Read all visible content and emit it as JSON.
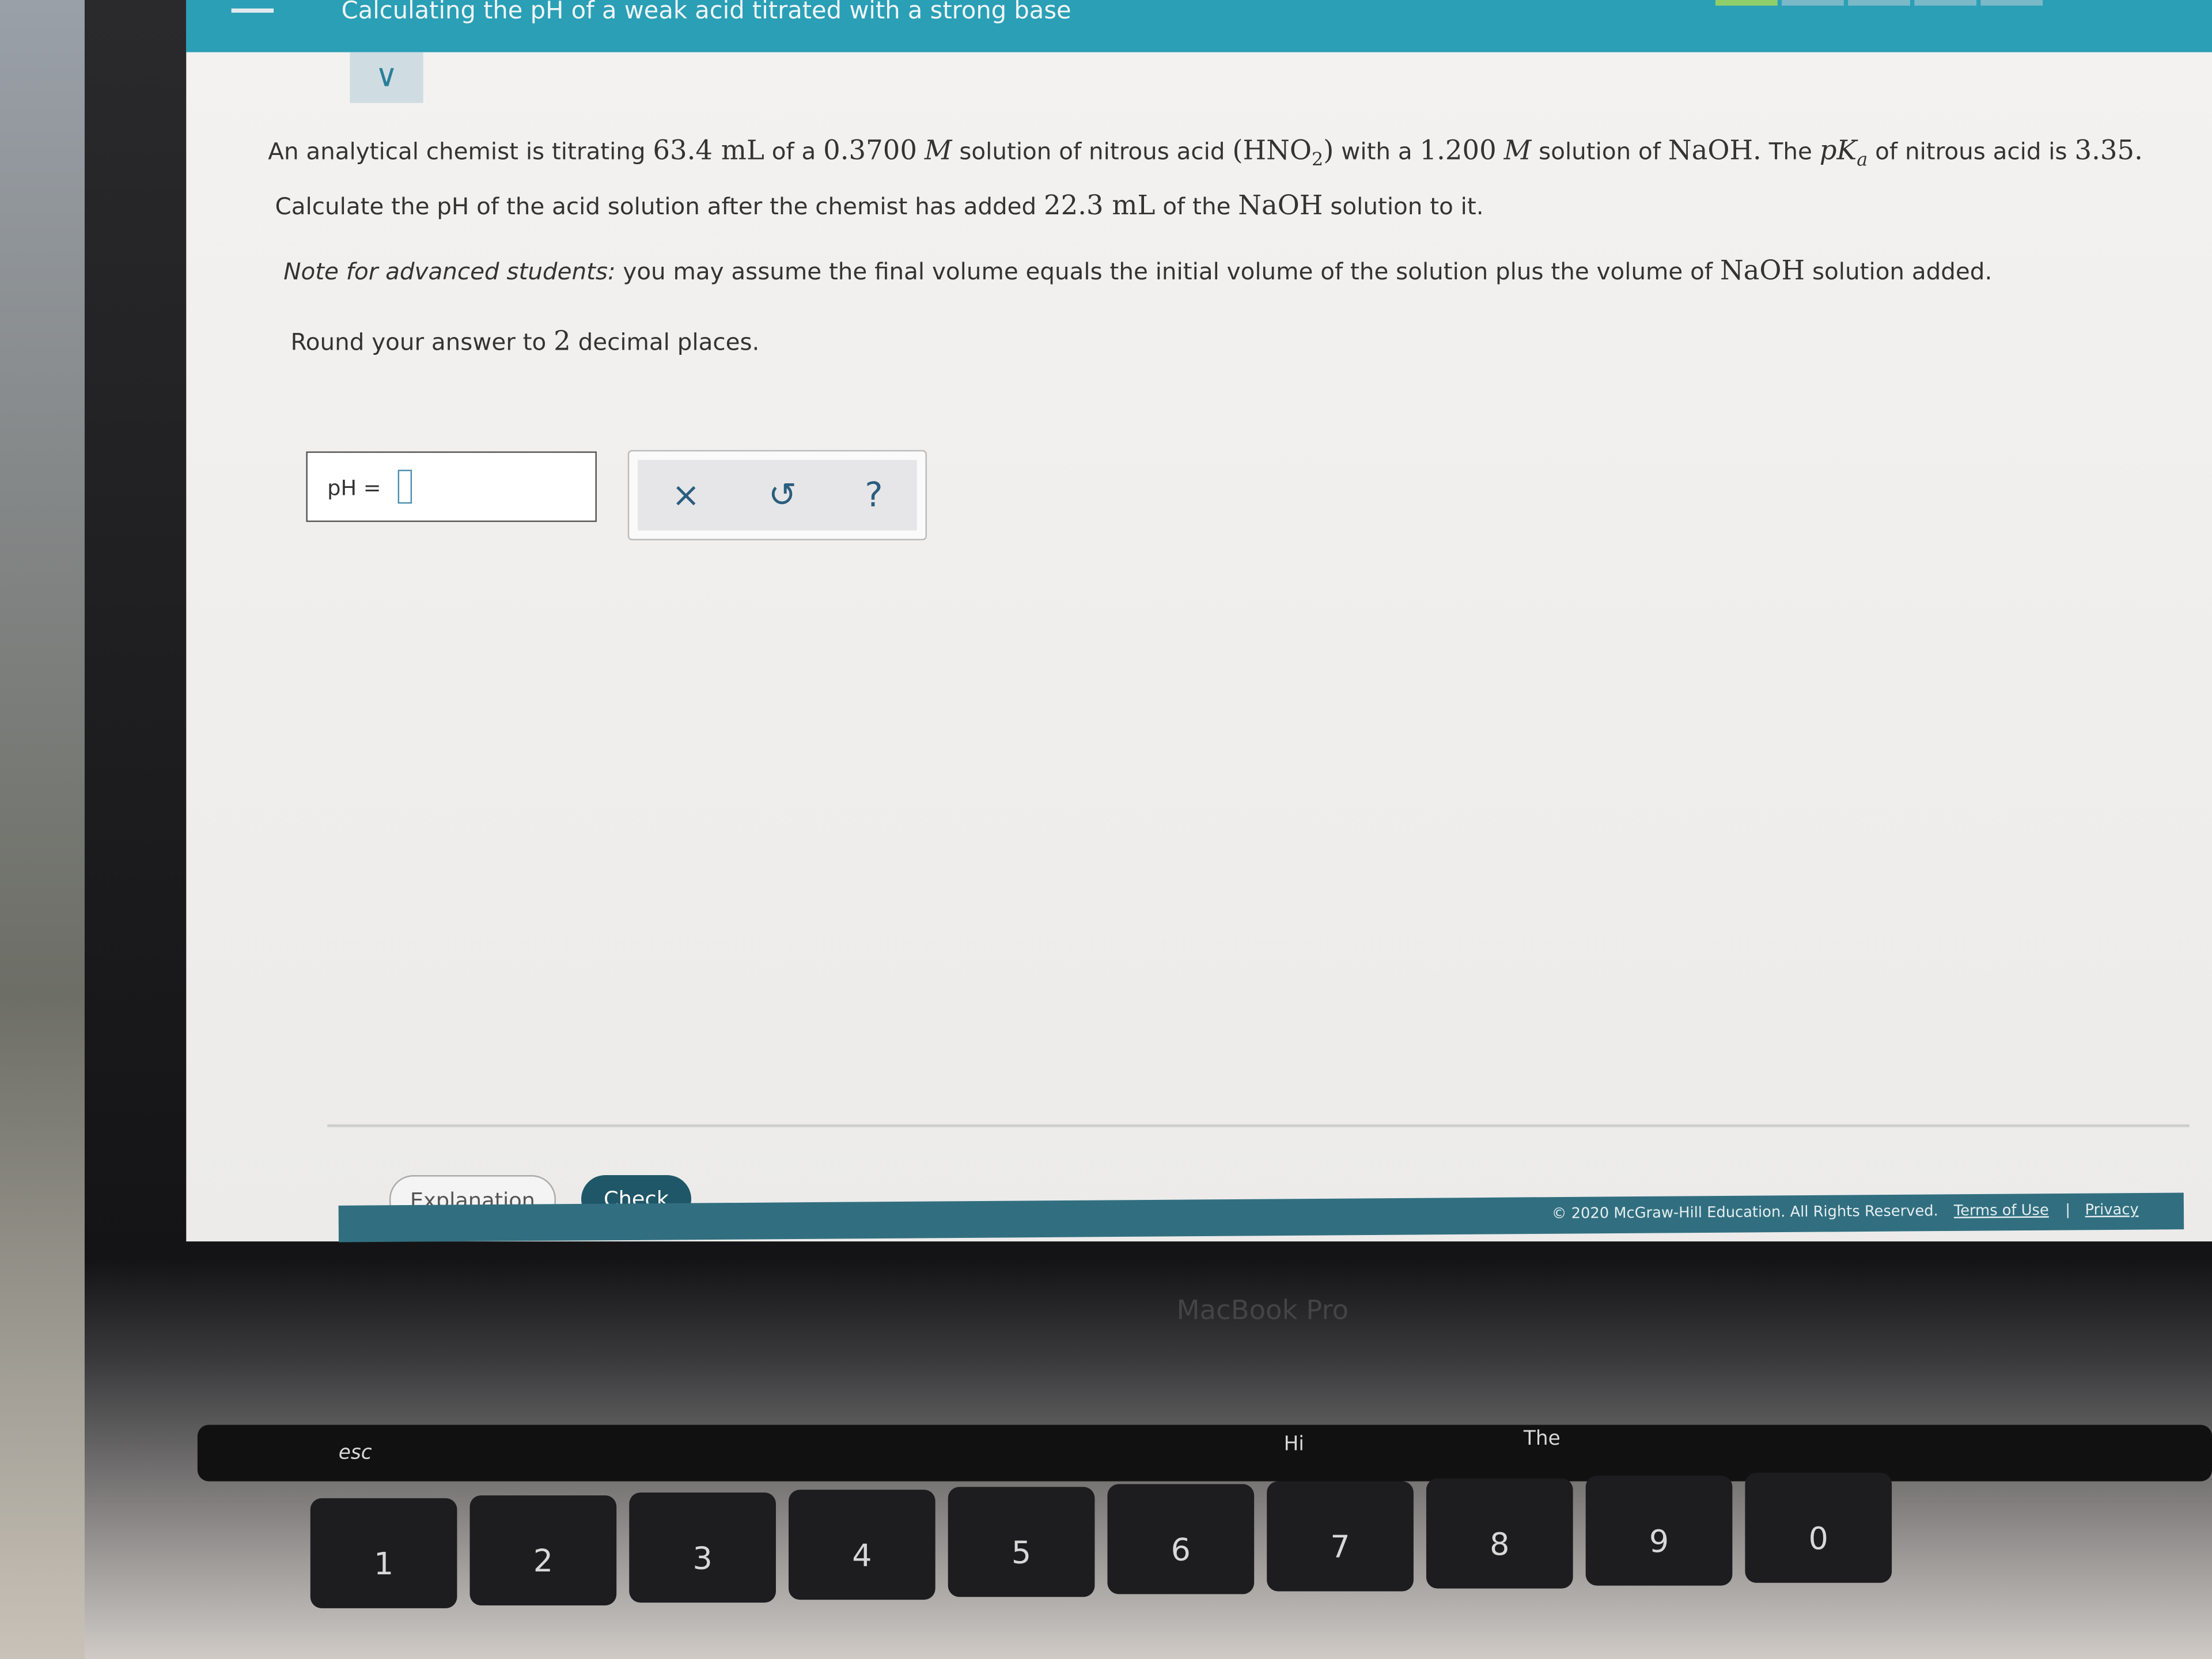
{
  "header": {
    "title": "Calculating the pH of a weak acid titrated with a strong base",
    "progress": {
      "completed_segments": 1,
      "total_segments": 5,
      "complete_color": "#8fcf6a"
    }
  },
  "question": {
    "line1": {
      "a": "An analytical chemist is titrating",
      "v1": "63.4 mL",
      "b": "of a",
      "v2": "0.3700",
      "m1": "M",
      "c": "solution of nitrous acid",
      "formula": "(HNO",
      "sub": "2",
      "close": ")",
      "d": "with a",
      "v3": "1.200",
      "m2": "M",
      "e": "solution of",
      "naoh": "NaOH.",
      "f": "The",
      "pk": "pK",
      "pksub": "a",
      "g": "of nitrous acid is",
      "pkval": "3.35."
    },
    "line2": {
      "a": "Calculate the pH of the acid solution after the chemist has added",
      "v": "22.3 mL",
      "b": "of the",
      "naoh": "NaOH",
      "c": "solution to it."
    },
    "note": {
      "em": "Note for advanced students:",
      "text": "you may assume the final volume equals the initial volume of the solution plus the volume of",
      "naoh": "NaOH",
      "end": "solution added."
    },
    "round": {
      "a": "Round your answer to",
      "n": "2",
      "b": "decimal places."
    }
  },
  "answer": {
    "label": "pH =",
    "value": ""
  },
  "tools": {
    "clear": "×",
    "undo": "↺",
    "help": "?"
  },
  "buttons": {
    "explanation": "Explanation",
    "check": "Check"
  },
  "footer": {
    "copyright": "© 2020 McGraw-Hill Education. All Rights Reserved.",
    "terms": "Terms of Use",
    "sep": "|",
    "privacy": "Privacy"
  },
  "laptop": {
    "brand": "MacBook Pro"
  },
  "keyboard": {
    "touchbar": [
      "esc",
      "Hi",
      "The"
    ],
    "numbers": [
      "1",
      "2",
      "3",
      "4",
      "5",
      "6",
      "7",
      "8",
      "9",
      "0"
    ]
  }
}
